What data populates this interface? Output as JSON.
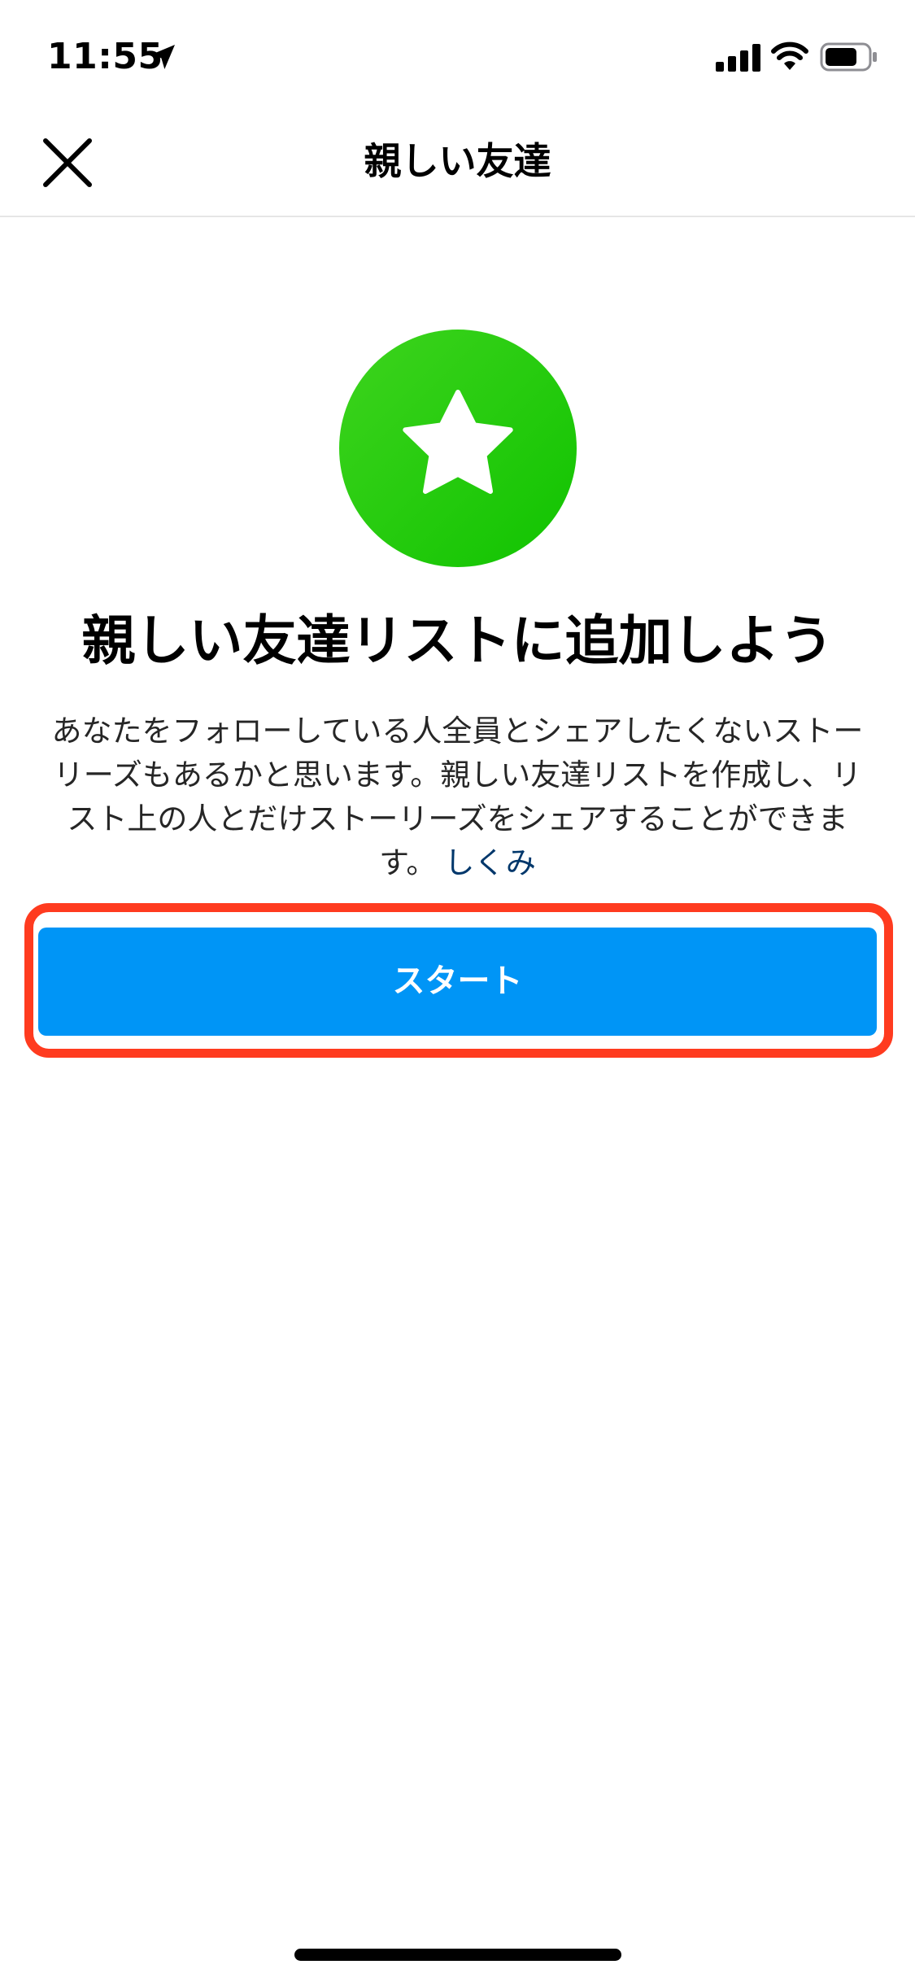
{
  "status_bar": {
    "time": "11:55",
    "location_icon": "location-arrow-icon",
    "signal_icon": "cellular-signal-icon",
    "wifi_icon": "wifi-icon",
    "battery_icon": "battery-icon"
  },
  "nav": {
    "title": "親しい友達",
    "close_icon": "close-icon"
  },
  "hero": {
    "icon": "star-icon",
    "gradient_start": "#3ed41e",
    "gradient_end": "#10c300"
  },
  "headline": "親しい友達リストに追加しよう",
  "description": {
    "body": "あなたをフォローしている人全員とシェアしたくないストーリーズもあるかと思います。親しい友達リストを作成し、リスト上の人とだけストーリーズをシェアすることができます。",
    "link": "しくみ"
  },
  "start_button": {
    "label": "スタート",
    "color": "#0095f6"
  },
  "highlight_color": "#ff3b1f"
}
